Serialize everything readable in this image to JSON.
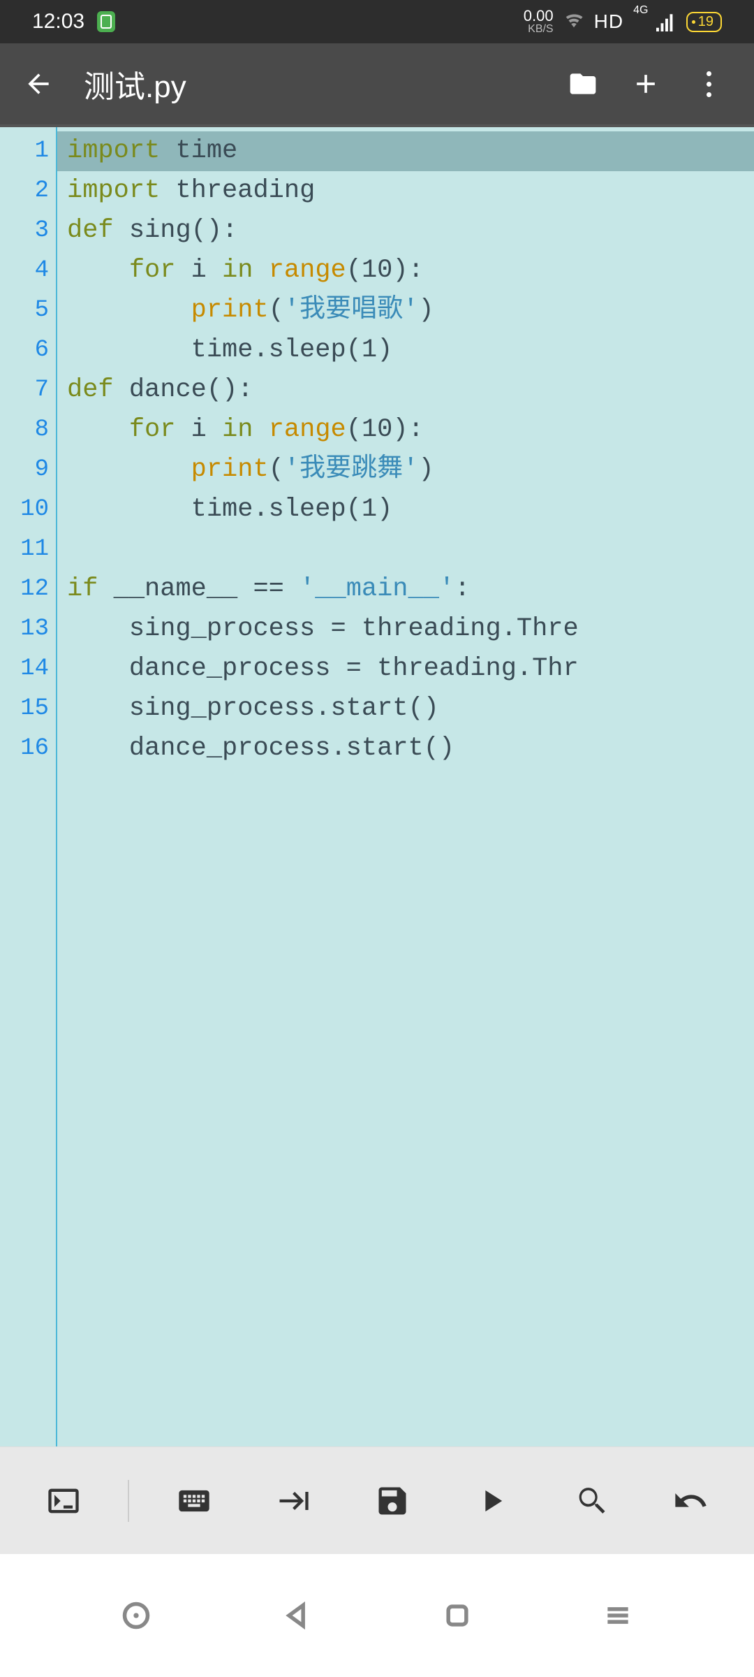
{
  "status": {
    "time": "12:03",
    "speed_value": "0.00",
    "speed_unit": "KB/S",
    "hd": "HD",
    "signal_gen": "4G",
    "battery": "19"
  },
  "header": {
    "title": "测试.py"
  },
  "editor": {
    "lines": [
      {
        "n": "1",
        "highlighted": true,
        "tokens": [
          {
            "t": "import",
            "c": "kw"
          },
          {
            "t": " time",
            "c": "id"
          }
        ]
      },
      {
        "n": "2",
        "tokens": [
          {
            "t": "import",
            "c": "kw"
          },
          {
            "t": " threading",
            "c": "id"
          }
        ]
      },
      {
        "n": "3",
        "tokens": [
          {
            "t": "def",
            "c": "kw"
          },
          {
            "t": " ",
            "c": "id"
          },
          {
            "t": "sing",
            "c": "id"
          },
          {
            "t": "():",
            "c": "op"
          }
        ]
      },
      {
        "n": "4",
        "tokens": [
          {
            "t": "    ",
            "c": "id"
          },
          {
            "t": "for",
            "c": "kw"
          },
          {
            "t": " i ",
            "c": "id"
          },
          {
            "t": "in",
            "c": "kw"
          },
          {
            "t": " ",
            "c": "id"
          },
          {
            "t": "range",
            "c": "fn"
          },
          {
            "t": "(",
            "c": "op"
          },
          {
            "t": "10",
            "c": "num"
          },
          {
            "t": "):",
            "c": "op"
          }
        ]
      },
      {
        "n": "5",
        "tokens": [
          {
            "t": "        ",
            "c": "id"
          },
          {
            "t": "print",
            "c": "fn"
          },
          {
            "t": "(",
            "c": "op"
          },
          {
            "t": "'我要唱歌'",
            "c": "str"
          },
          {
            "t": ")",
            "c": "op"
          }
        ]
      },
      {
        "n": "6",
        "tokens": [
          {
            "t": "        time.sleep(",
            "c": "id"
          },
          {
            "t": "1",
            "c": "num"
          },
          {
            "t": ")",
            "c": "op"
          }
        ]
      },
      {
        "n": "7",
        "tokens": [
          {
            "t": "def",
            "c": "kw"
          },
          {
            "t": " ",
            "c": "id"
          },
          {
            "t": "dance",
            "c": "id"
          },
          {
            "t": "():",
            "c": "op"
          }
        ]
      },
      {
        "n": "8",
        "tokens": [
          {
            "t": "    ",
            "c": "id"
          },
          {
            "t": "for",
            "c": "kw"
          },
          {
            "t": " i ",
            "c": "id"
          },
          {
            "t": "in",
            "c": "kw"
          },
          {
            "t": " ",
            "c": "id"
          },
          {
            "t": "range",
            "c": "fn"
          },
          {
            "t": "(",
            "c": "op"
          },
          {
            "t": "10",
            "c": "num"
          },
          {
            "t": "):",
            "c": "op"
          }
        ]
      },
      {
        "n": "9",
        "tokens": [
          {
            "t": "        ",
            "c": "id"
          },
          {
            "t": "print",
            "c": "fn"
          },
          {
            "t": "(",
            "c": "op"
          },
          {
            "t": "'我要跳舞'",
            "c": "str"
          },
          {
            "t": ")",
            "c": "op"
          }
        ]
      },
      {
        "n": "10",
        "tokens": [
          {
            "t": "        time.sleep(",
            "c": "id"
          },
          {
            "t": "1",
            "c": "num"
          },
          {
            "t": ")",
            "c": "op"
          }
        ]
      },
      {
        "n": "11",
        "tokens": []
      },
      {
        "n": "12",
        "tokens": [
          {
            "t": "if",
            "c": "kw"
          },
          {
            "t": " __name__ == ",
            "c": "id"
          },
          {
            "t": "'__main__'",
            "c": "str"
          },
          {
            "t": ":",
            "c": "op"
          }
        ]
      },
      {
        "n": "13",
        "tokens": [
          {
            "t": "    sing_process = threading.Thre",
            "c": "id"
          }
        ]
      },
      {
        "n": "14",
        "tokens": [
          {
            "t": "    dance_process = threading.Thr",
            "c": "id"
          }
        ]
      },
      {
        "n": "15",
        "tokens": [
          {
            "t": "    sing_process.start()",
            "c": "id"
          }
        ]
      },
      {
        "n": "16",
        "tokens": [
          {
            "t": "    dance_process.start()",
            "c": "id"
          }
        ]
      }
    ]
  }
}
